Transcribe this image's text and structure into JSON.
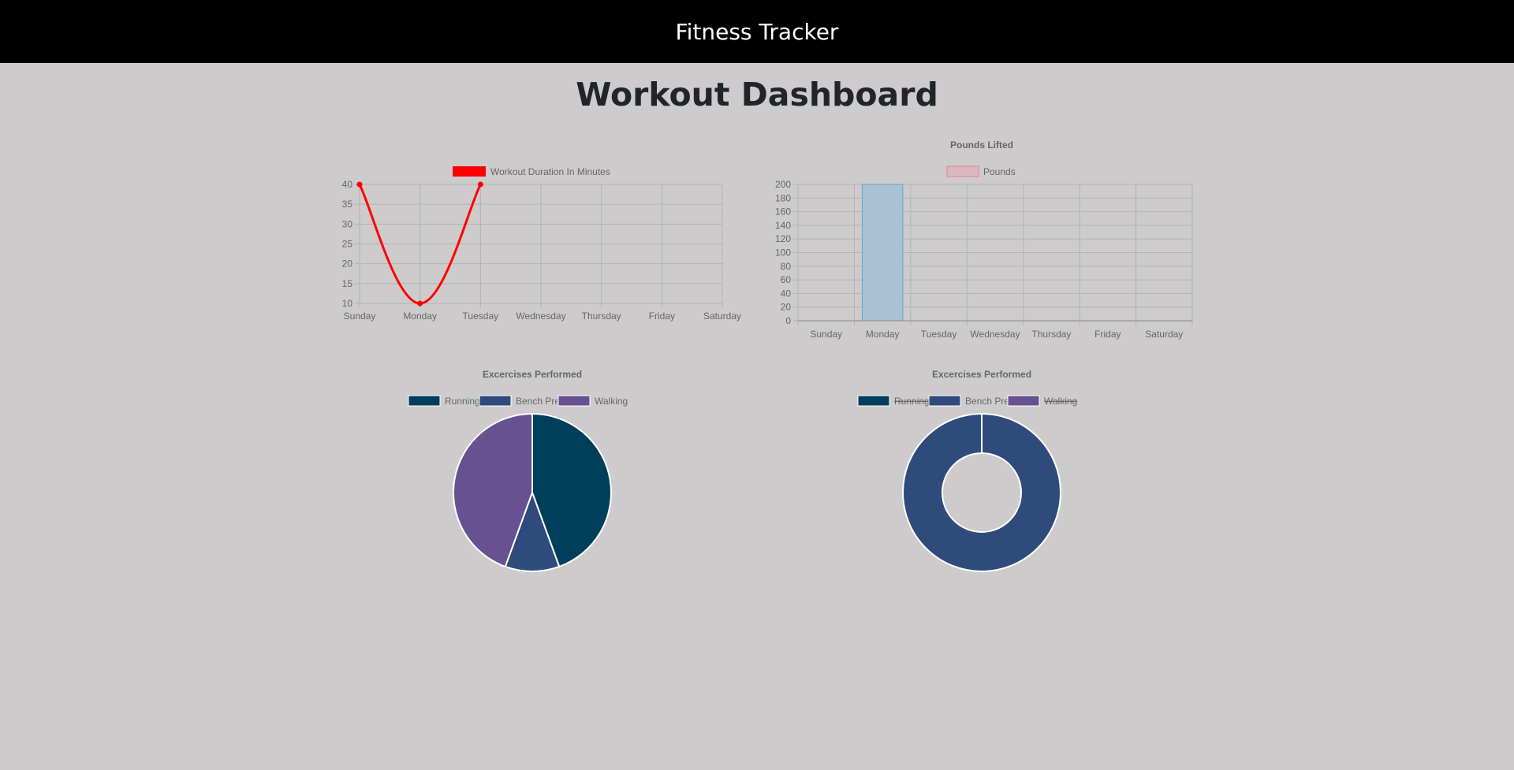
{
  "header": {
    "brand": "Fitness Tracker"
  },
  "page": {
    "title": "Workout Dashboard"
  },
  "colors": {
    "background": "#cdcbcc",
    "navbar": "#000000",
    "line": "#ff0000",
    "bar_fill": "#a9c2d3",
    "bar_border": "#5ea3d4",
    "pounds_legend_fill": "#d9b8bf",
    "pounds_legend_border": "#ef7d8f",
    "running": "#003f5c",
    "bench_press": "#2f4b7c",
    "walking": "#665191",
    "grid": "#b3b3b3"
  },
  "chart_data": [
    {
      "id": "duration",
      "type": "line",
      "title": "",
      "legend": "Workout Duration In Minutes",
      "categories": [
        "Sunday",
        "Monday",
        "Tuesday",
        "Wednesday",
        "Thursday",
        "Friday",
        "Saturday"
      ],
      "values": [
        40,
        10,
        40
      ],
      "ylim": [
        10,
        40
      ],
      "yticks": [
        "40",
        "35",
        "30",
        "25",
        "20",
        "15",
        "10"
      ],
      "grid": true
    },
    {
      "id": "pounds",
      "type": "bar",
      "title": "Pounds Lifted",
      "legend": "Pounds",
      "categories": [
        "Sunday",
        "Monday",
        "Tuesday",
        "Wednesday",
        "Thursday",
        "Friday",
        "Saturday"
      ],
      "values": [
        0,
        200,
        0,
        0,
        0,
        0,
        0
      ],
      "ylim": [
        0,
        200
      ],
      "yticks": [
        "200",
        "180",
        "160",
        "140",
        "120",
        "100",
        "80",
        "60",
        "40",
        "20",
        "0"
      ],
      "grid": true
    },
    {
      "id": "exercises_pie",
      "type": "pie",
      "title": "Excercises Performed",
      "labels": [
        "Running",
        "Bench Press",
        "Walking"
      ],
      "values": [
        40,
        10,
        40
      ],
      "legend_position": "top"
    },
    {
      "id": "exercises_doughnut",
      "type": "doughnut",
      "title": "Excercises Performed",
      "labels": [
        "Running",
        "Bench Press",
        "Walking"
      ],
      "values": [
        40,
        10,
        40
      ],
      "hidden": [
        true,
        false,
        true
      ],
      "legend_position": "top"
    }
  ]
}
